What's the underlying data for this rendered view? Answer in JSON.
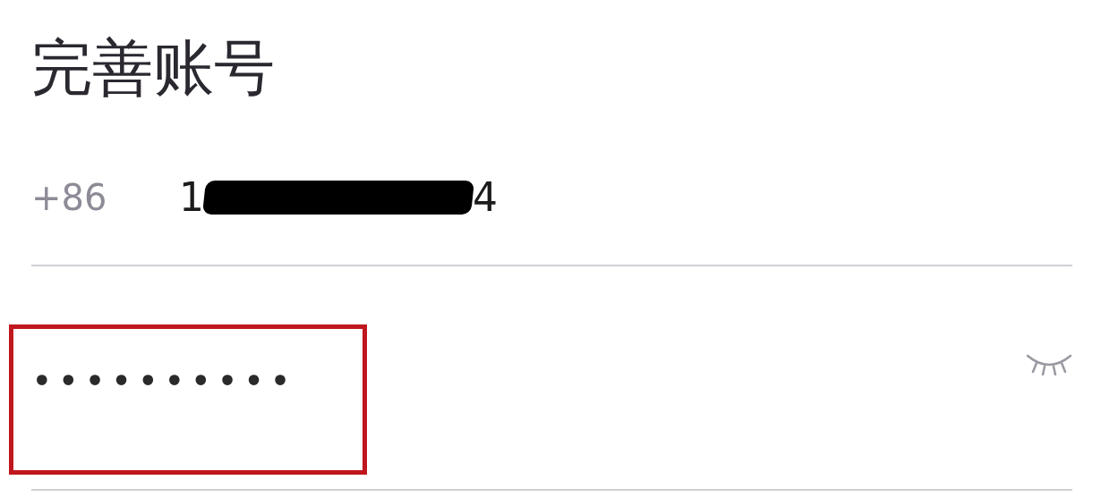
{
  "title": "完善账号",
  "phone": {
    "country_code": "+86",
    "value_start": "1",
    "value_end": "4",
    "redacted": true
  },
  "password": {
    "value": "••••••••••",
    "highlighted": true,
    "visible": false
  }
}
